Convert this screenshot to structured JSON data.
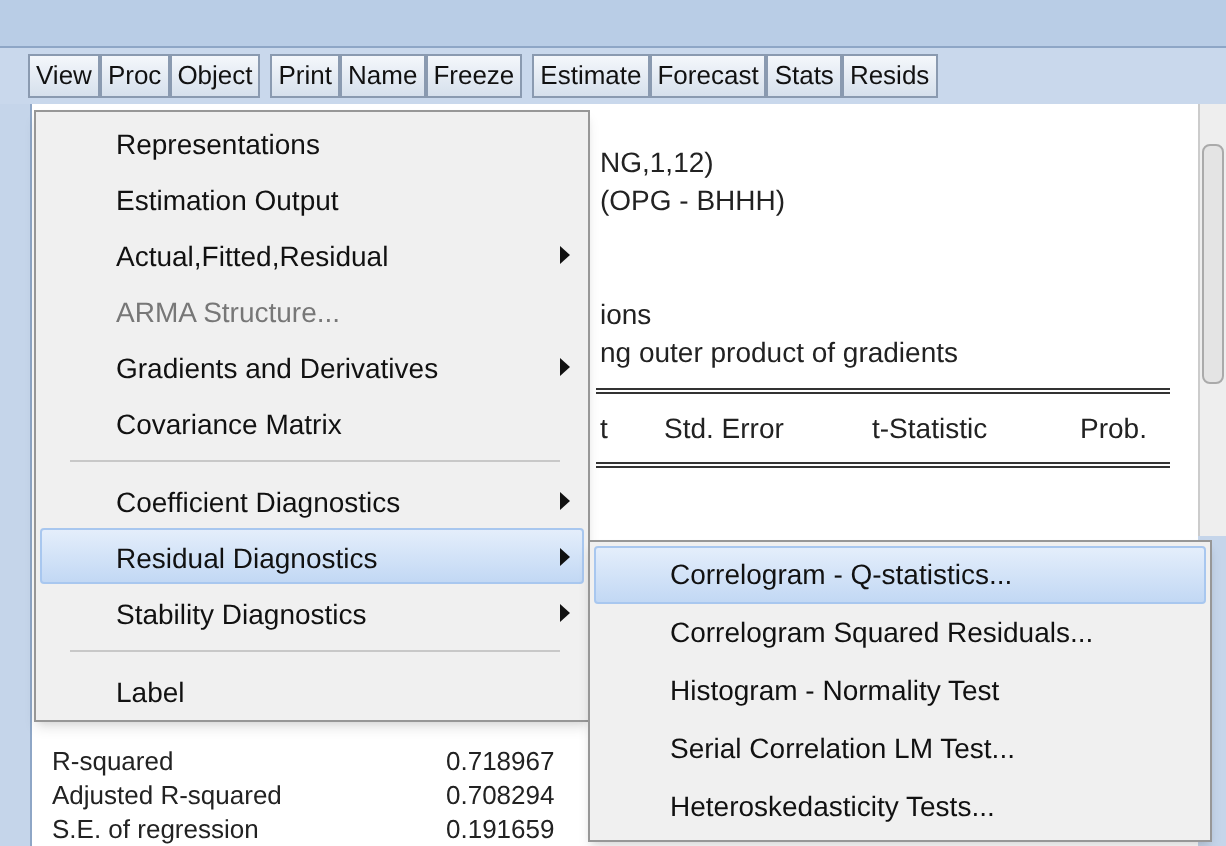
{
  "toolbar_groups": [
    [
      "View",
      "Proc",
      "Object"
    ],
    [
      "Print",
      "Name",
      "Freeze"
    ],
    [
      "Estimate",
      "Forecast",
      "Stats",
      "Resids"
    ]
  ],
  "header_lines": [
    "NG,1,12)",
    "(OPG - BHHH)"
  ],
  "note_lines": [
    "ions",
    "ng outer product of gradients"
  ],
  "table_header": [
    "t",
    "Std. Error",
    "t-Statistic",
    "Prob."
  ],
  "stats": [
    {
      "label": "R-squared",
      "value": "0.718967"
    },
    {
      "label": "Adjusted R-squared",
      "value": "0.708294"
    },
    {
      "label": "S.E. of regression",
      "value": "0.191659"
    }
  ],
  "menu": [
    {
      "kind": "item",
      "label": "Representations",
      "disabled": false,
      "submenu": false,
      "selected": false
    },
    {
      "kind": "item",
      "label": "Estimation Output",
      "disabled": false,
      "submenu": false,
      "selected": false
    },
    {
      "kind": "item",
      "label": "Actual,Fitted,Residual",
      "disabled": false,
      "submenu": true,
      "selected": false
    },
    {
      "kind": "item",
      "label": "ARMA Structure...",
      "disabled": true,
      "submenu": false,
      "selected": false
    },
    {
      "kind": "item",
      "label": "Gradients and Derivatives",
      "disabled": false,
      "submenu": true,
      "selected": false
    },
    {
      "kind": "item",
      "label": "Covariance Matrix",
      "disabled": false,
      "submenu": false,
      "selected": false
    },
    {
      "kind": "separator"
    },
    {
      "kind": "item",
      "label": "Coefficient Diagnostics",
      "disabled": false,
      "submenu": true,
      "selected": false
    },
    {
      "kind": "item",
      "label": "Residual Diagnostics",
      "disabled": false,
      "submenu": true,
      "selected": true
    },
    {
      "kind": "item",
      "label": "Stability Diagnostics",
      "disabled": false,
      "submenu": true,
      "selected": false
    },
    {
      "kind": "separator"
    },
    {
      "kind": "item",
      "label": "Label",
      "disabled": false,
      "submenu": false,
      "selected": false
    }
  ],
  "submenu": [
    {
      "label": "Correlogram - Q-statistics...",
      "selected": true
    },
    {
      "label": "Correlogram Squared Residuals...",
      "selected": false
    },
    {
      "label": "Histogram - Normality Test",
      "selected": false
    },
    {
      "label": "Serial Correlation LM Test...",
      "selected": false
    },
    {
      "label": "Heteroskedasticity Tests...",
      "selected": false
    }
  ]
}
